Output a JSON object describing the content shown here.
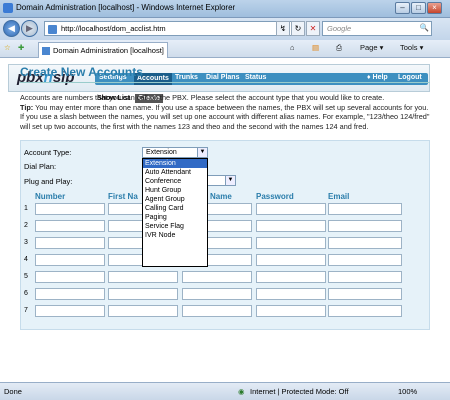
{
  "window": {
    "title": "Domain Administration [localhost] - Windows Internet Explorer",
    "min": "–",
    "max": "□",
    "close": "×"
  },
  "browser": {
    "url": "http://localhost/dom_acclist.htm",
    "search_placeholder": "Google",
    "tab_title": "Domain Administration [localhost]",
    "tools": {
      "page": "Page ▾",
      "tools": "Tools ▾"
    },
    "star": "☆",
    "star_add": "✚",
    "search_go": "🔍",
    "home": "⌂",
    "feeds": "▤",
    "print": "⎙"
  },
  "app": {
    "logo_a": "pbx",
    "logo_b": "n",
    "logo_c": "sip",
    "nav": [
      "Settings",
      "Accounts",
      "Trunks",
      "Dial Plans",
      "Status"
    ],
    "nav_right": [
      "Help",
      "Logout"
    ],
    "subnav": [
      "Show List",
      "Create"
    ]
  },
  "content": {
    "heading": "Create New Accounts",
    "intro_1": "Accounts are numbers that you can call on the PBX. Please select the account type that you would like to create.",
    "tip_label": "Tip:",
    "intro_2": " You may enter more than one name. If you use a space between the names, the PBX will set up several accounts for you. If you use a slash between the names, you will set up one account with different alias names. For example, \"123/theo 124/fred\" will set up two accounts, the first with the names 123 and theo and the second with the names 124 and fred."
  },
  "form": {
    "account_type_label": "Account Type:",
    "account_type_value": "Extension",
    "dial_plan_label": "Dial Plan:",
    "plug_label": "Plug and Play:",
    "options": [
      "Extension",
      "Auto Attendant",
      "Conference",
      "Hunt Group",
      "Agent Group",
      "Calling Card",
      "Paging",
      "Service Flag",
      "IVR Node"
    ],
    "columns": [
      "Number",
      "First Na",
      "Name",
      "Password",
      "Email"
    ],
    "rows": [
      "1",
      "2",
      "3",
      "4",
      "5",
      "6",
      "7"
    ]
  },
  "status": {
    "left": "Done",
    "zone": "Internet | Protected Mode: Off",
    "zoom": "100%"
  }
}
